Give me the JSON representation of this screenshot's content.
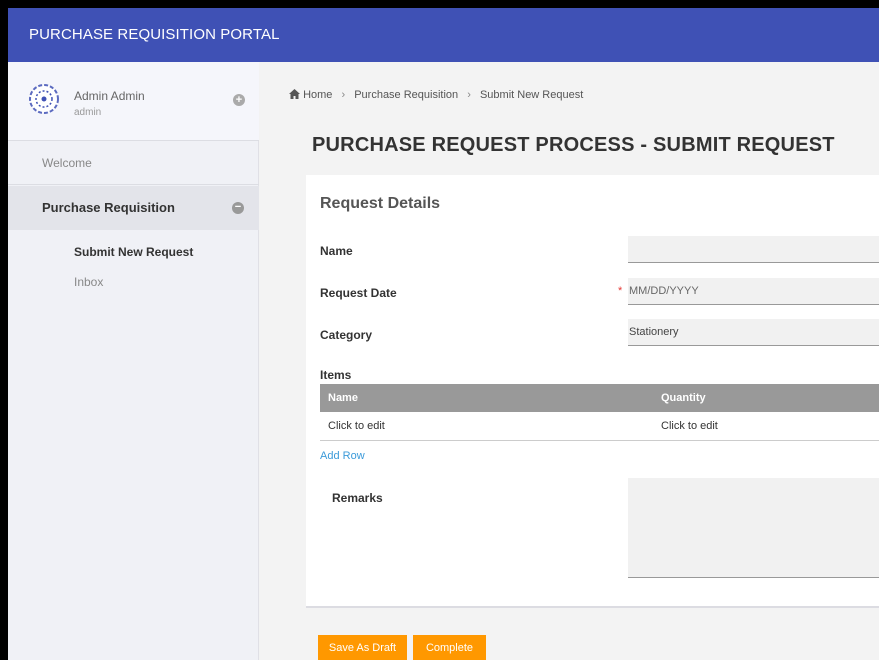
{
  "app": {
    "title": "PURCHASE REQUISITION PORTAL"
  },
  "user": {
    "name": "Admin Admin",
    "role": "admin",
    "toggle": "+"
  },
  "nav": {
    "welcome": "Welcome",
    "purchase_requisition": "Purchase Requisition",
    "purchase_requisition_toggle": "−",
    "sub_items": [
      "Submit New Request",
      "Inbox"
    ]
  },
  "breadcrumb": {
    "home": "Home",
    "items": [
      "Purchase Requisition",
      "Submit New Request"
    ],
    "separator": "›"
  },
  "page_title": "PURCHASE REQUEST PROCESS - SUBMIT REQUEST",
  "form": {
    "card_title": "Request Details",
    "name_label": "Name",
    "name_value": "",
    "request_date_label": "Request Date",
    "request_date_placeholder": "MM/DD/YYYY",
    "required_marker": "*",
    "category_label": "Category",
    "category_value": "Stationery",
    "items_label": "Items",
    "items_columns": [
      "Name",
      "Quantity"
    ],
    "items_rows": [
      [
        "Click to edit",
        "Click to edit"
      ]
    ],
    "add_row": "Add Row",
    "remarks_label": "Remarks"
  },
  "actions": {
    "save_draft": "Save As Draft",
    "complete": "Complete"
  },
  "colors": {
    "header": "#3f51b5",
    "accent_button": "#ff9800",
    "link": "#3b9ad9",
    "required": "#e53935"
  }
}
